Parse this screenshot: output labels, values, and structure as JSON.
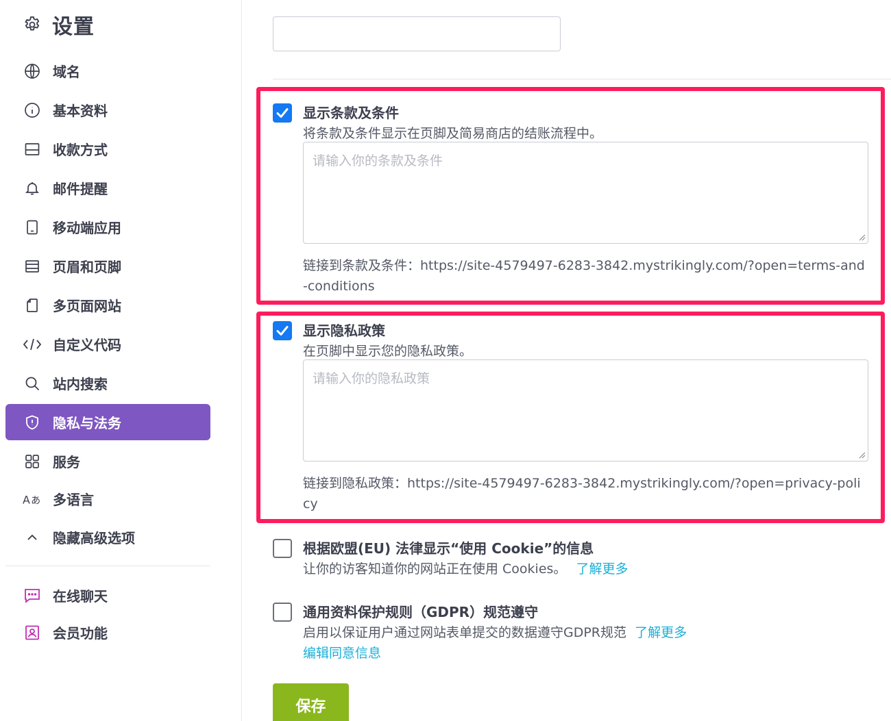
{
  "sidebar": {
    "title": "设置",
    "items": [
      {
        "label": "域名",
        "icon": "globe-icon"
      },
      {
        "label": "基本资料",
        "icon": "info-icon"
      },
      {
        "label": "收款方式",
        "icon": "payment-icon"
      },
      {
        "label": "邮件提醒",
        "icon": "bell-icon"
      },
      {
        "label": "移动端应用",
        "icon": "mobile-icon"
      },
      {
        "label": "页眉和页脚",
        "icon": "header-footer-icon"
      },
      {
        "label": "多页面网站",
        "icon": "pages-icon"
      },
      {
        "label": "自定义代码",
        "icon": "code-icon"
      },
      {
        "label": "站内搜索",
        "icon": "search-icon"
      },
      {
        "label": "隐私与法务",
        "icon": "shield-icon",
        "active": true
      },
      {
        "label": "服务",
        "icon": "grid-icon"
      },
      {
        "label": "多语言",
        "icon": "language-icon"
      },
      {
        "label": "隐藏高级选项",
        "icon": "chevron-up-icon"
      }
    ],
    "extra_items": [
      {
        "label": "在线聊天",
        "icon": "chat-icon"
      },
      {
        "label": "会员功能",
        "icon": "member-icon"
      }
    ]
  },
  "main": {
    "terms": {
      "title": "显示条款及条件",
      "checked": true,
      "description": "将条款及条件显示在页脚及简易商店的结账流程中。",
      "placeholder": "请输入你的条款及条件",
      "link_text": "链接到条款及条件：https://site-4579497-6283-3842.mystrikingly.com/?open=terms-and-conditions"
    },
    "privacy": {
      "title": "显示隐私政策",
      "checked": true,
      "description": "在页脚中显示您的隐私政策。",
      "placeholder": "请输入你的隐私政策",
      "link_text": "链接到隐私政策：https://site-4579497-6283-3842.mystrikingly.com/?open=privacy-policy"
    },
    "cookie": {
      "title": "根据欧盟(EU) 法律显示“使用 Cookie”的信息",
      "checked": false,
      "description": "让你的访客知道你的网站正在使用 Cookies。",
      "learn_more": "了解更多"
    },
    "gdpr": {
      "title": "通用资料保护规则（GDPR）规范遵守",
      "checked": false,
      "description": "启用以保证用户通过网站表单提交的数据遵守GDPR规范",
      "learn_more": "了解更多",
      "edit_consent": "编辑同意信息"
    },
    "save_label": "保存"
  },
  "colors": {
    "accent": "#7e57c2",
    "highlight": "#ff1c5c",
    "checkbox": "#1479f2",
    "link": "#1ab0d8",
    "save": "#8bb71e",
    "member_icon": "#c02fb3"
  }
}
